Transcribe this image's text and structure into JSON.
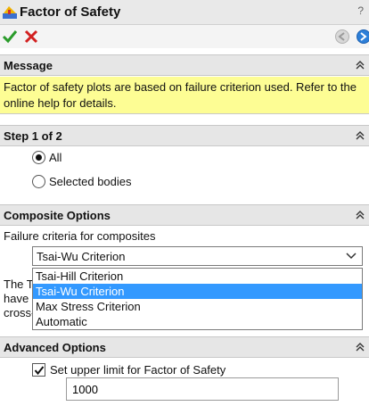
{
  "header": {
    "title": "Factor of Safety",
    "help": "?"
  },
  "message": {
    "title": "Message",
    "text": "Factor of safety plots are based on failure criterion used. Refer to the online help for details."
  },
  "step": {
    "title": "Step 1 of 2",
    "options": [
      {
        "label": "All",
        "selected": true
      },
      {
        "label": "Selected bodies",
        "selected": false
      }
    ]
  },
  "composite": {
    "title": "Composite Options",
    "criteria_label": "Failure criteria for composites",
    "selected": "Tsai-Wu Criterion",
    "options": [
      "Tsai-Hill Criterion",
      "Tsai-Wu Criterion",
      "Max Stress Criterion",
      "Automatic"
    ],
    "obscured_text": [
      "The T",
      "have",
      "cross-"
    ]
  },
  "advanced": {
    "title": "Advanced Options",
    "upper_limit_label": "Set upper limit for Factor of Safety",
    "upper_limit_checked": true,
    "upper_limit_value": "1000"
  },
  "colors": {
    "message_bg": "#fdfd94",
    "highlight": "#3399ff",
    "ok": "#2a9b2a",
    "cancel": "#d22020"
  }
}
